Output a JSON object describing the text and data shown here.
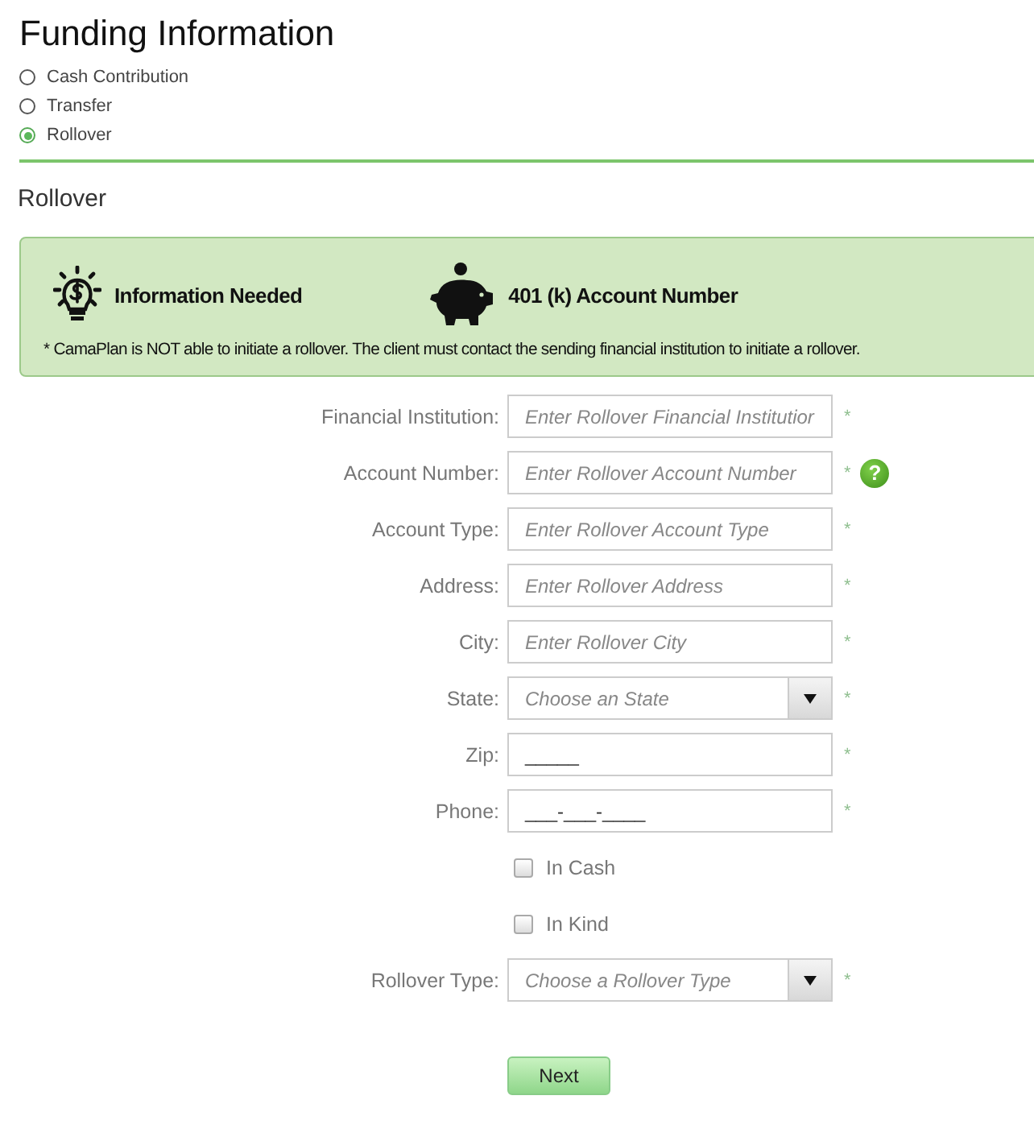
{
  "title": "Funding Information",
  "funding_options": [
    {
      "label": "Cash Contribution",
      "selected": false
    },
    {
      "label": "Transfer",
      "selected": false
    },
    {
      "label": "Rollover",
      "selected": true
    }
  ],
  "section_title": "Rollover",
  "info_box": {
    "items": [
      {
        "kind": "bulb",
        "label": "Information Needed"
      },
      {
        "kind": "piggy",
        "label": "401 (k) Account Number"
      }
    ],
    "note": "* CamaPlan is NOT able to initiate a rollover. The client must contact the sending financial institution to initiate a rollover."
  },
  "form": [
    {
      "kind": "text",
      "label": "Financial Institution:",
      "placeholder": "Enter Rollover Financial Institutior",
      "required_mark": "*"
    },
    {
      "kind": "text",
      "label": "Account Number:",
      "placeholder": "Enter Rollover Account Number",
      "required_mark": "*",
      "help_icon": "?"
    },
    {
      "kind": "text",
      "label": "Account Type:",
      "placeholder": "Enter Rollover Account Type",
      "required_mark": "*"
    },
    {
      "kind": "text",
      "label": "Address:",
      "placeholder": "Enter Rollover Address",
      "required_mark": "*"
    },
    {
      "kind": "text",
      "label": "City:",
      "placeholder": "Enter Rollover City",
      "required_mark": "*"
    },
    {
      "kind": "select",
      "label": "State:",
      "placeholder": "Choose an State",
      "required_mark": "*"
    },
    {
      "kind": "text",
      "label": "Zip:",
      "value": "_____",
      "required_mark": "*"
    },
    {
      "kind": "text",
      "label": "Phone:",
      "value": "___-___-____",
      "required_mark": "*"
    },
    {
      "kind": "checkbox",
      "label": "In Cash",
      "checked": false
    },
    {
      "kind": "checkbox",
      "label": "In Kind",
      "checked": false
    },
    {
      "kind": "select",
      "label": "Rollover Type:",
      "placeholder": "Choose a Rollover Type",
      "required_mark": "*"
    }
  ],
  "next_button": "Next"
}
